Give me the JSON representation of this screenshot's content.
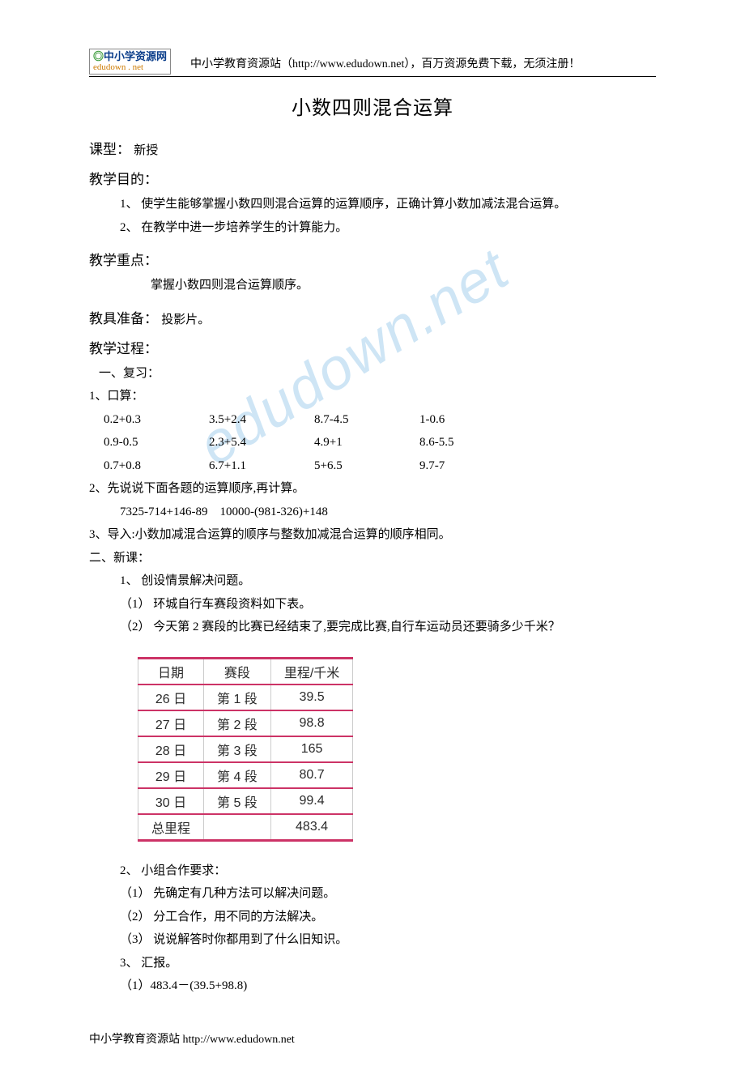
{
  "header": {
    "logo_top": "中小学资源网",
    "logo_bottom": "edudown . net",
    "text": "中小学教育资源站（http://www.edudown.net），百万资源免费下载，无须注册！"
  },
  "watermark": "edudown.net",
  "title": "小数四则混合运算",
  "sections": {
    "lesson_type": {
      "label": "课型：",
      "value": "新授"
    },
    "objectives": {
      "label": "教学目的：",
      "items": [
        "1、 使学生能够掌握小数四则混合运算的运算顺序，正确计算小数加减法混合运算。",
        "2、 在教学中进一步培养学生的计算能力。"
      ]
    },
    "focus": {
      "label": "教学重点：",
      "value": "掌握小数四则混合运算顺序。"
    },
    "tools": {
      "label": "教具准备：",
      "value": "投影片。"
    },
    "process": {
      "label": "教学过程："
    }
  },
  "review": {
    "heading": "一、复习：",
    "mental_label": "1、口算：",
    "mental_rows": [
      [
        "0.2+0.3",
        "3.5+2.4",
        "8.7-4.5",
        "1-0.6"
      ],
      [
        "0.9-0.5",
        "2.3+5.4",
        "4.9+1",
        "8.6-5.5"
      ],
      [
        "0.7+0.8",
        "6.7+1.1",
        "5+6.5",
        "9.7-7"
      ]
    ],
    "order_label": "2、先说说下面各题的运算顺序,再计算。",
    "order_exprs": "7325-714+146-89    10000-(981-326)+148",
    "intro": "3、导入:小数加减混合运算的顺序与整数加减混合运算的顺序相同。"
  },
  "newlesson": {
    "heading": "二、新课：",
    "item1": "1、 创设情景解决问题。",
    "item1_sub1": "（1）  环城自行车赛段资料如下表。",
    "item1_sub2": "（2）  今天第 2 赛段的比赛已经结束了,要完成比赛,自行车运动员还要骑多少千米？",
    "item2": "2、 小组合作要求：",
    "item2_sub1": "（1）  先确定有几种方法可以解决问题。",
    "item2_sub2": "（2）  分工合作，用不同的方法解决。",
    "item2_sub3": "（3）  说说解答时你都用到了什么旧知识。",
    "item3": "3、 汇报。",
    "item3_sub1": "（1）483.4－(39.5+98.8)"
  },
  "chart_data": {
    "type": "table",
    "headers": [
      "日期",
      "赛段",
      "里程/千米"
    ],
    "rows": [
      [
        "26 日",
        "第 1 段",
        "39.5"
      ],
      [
        "27 日",
        "第 2 段",
        "98.8"
      ],
      [
        "28 日",
        "第 3 段",
        "165"
      ],
      [
        "29 日",
        "第 4 段",
        "80.7"
      ],
      [
        "30 日",
        "第 5 段",
        "99.4"
      ],
      [
        "总里程",
        "",
        "483.4"
      ]
    ]
  },
  "footer": "中小学教育资源站  http://www.edudown.net"
}
